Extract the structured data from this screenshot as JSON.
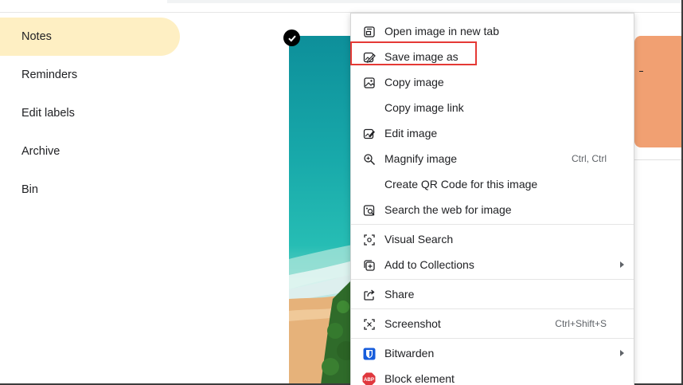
{
  "sidebar": {
    "items": [
      {
        "label": "Notes",
        "active": true
      },
      {
        "label": "Reminders"
      },
      {
        "label": "Edit labels"
      },
      {
        "label": "Archive"
      },
      {
        "label": "Bin"
      }
    ]
  },
  "note": {
    "card_color": "#f1a072",
    "card_text": "-"
  },
  "context_menu": {
    "items": [
      {
        "label": "Open image in new tab",
        "icon": "open-tab-icon"
      },
      {
        "label": "Save image as",
        "icon": "save-image-icon",
        "highlighted": true
      },
      {
        "label": "Copy image",
        "icon": "image-icon"
      },
      {
        "label": "Copy image link",
        "icon": ""
      },
      {
        "label": "Edit image",
        "icon": "edit-image-icon"
      },
      {
        "label": "Magnify image",
        "icon": "magnify-icon",
        "shortcut": "Ctrl, Ctrl"
      },
      {
        "label": "Create QR Code for this image",
        "icon": ""
      },
      {
        "label": "Search the web for image",
        "icon": "search-image-icon"
      },
      {
        "label": "Visual Search",
        "icon": "visual-search-icon"
      },
      {
        "label": "Add to Collections",
        "icon": "collections-icon",
        "submenu": true
      },
      {
        "label": "Share",
        "icon": "share-icon"
      },
      {
        "label": "Screenshot",
        "icon": "screenshot-icon",
        "shortcut": "Ctrl+Shift+S"
      },
      {
        "label": "Bitwarden",
        "icon": "bitwarden-icon",
        "submenu": true
      },
      {
        "label": "Block element",
        "icon": "abp-icon"
      }
    ]
  },
  "colors": {
    "active_nav": "#feefc3",
    "highlight_border": "#e53935",
    "bitwarden": "#175ddc",
    "abp": "#e0383e"
  },
  "icons": {
    "checkmark": "check-circle-icon",
    "abp_text": "ABP"
  }
}
